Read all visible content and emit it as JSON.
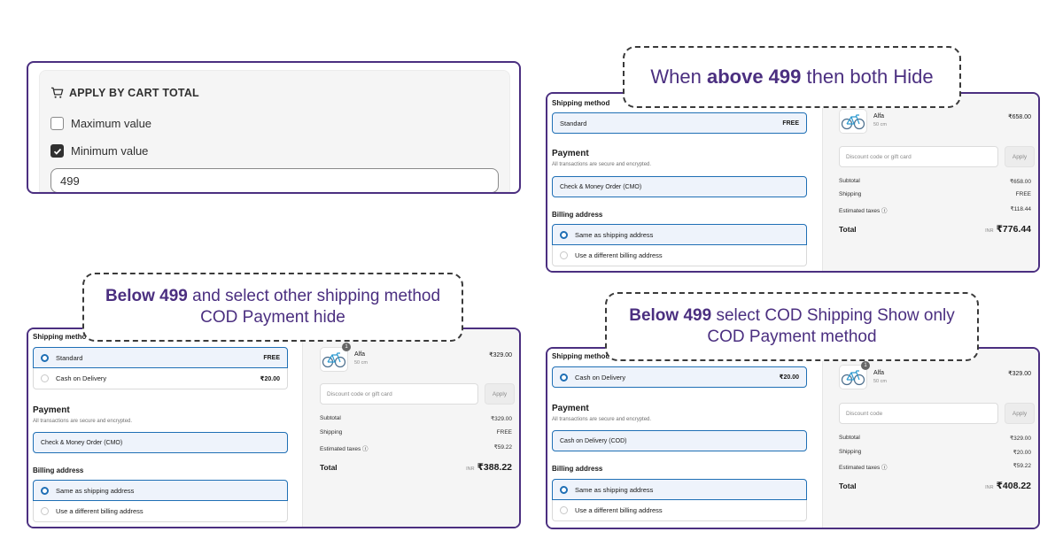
{
  "cart_total_rule": {
    "title": "APPLY BY CART TOTAL",
    "max_label": "Maximum value",
    "max_checked": false,
    "min_label": "Minimum value",
    "min_checked": true,
    "min_value": "499"
  },
  "callouts": {
    "above": {
      "pre": "When ",
      "bold": "above 499",
      "post": " then both Hide"
    },
    "below_other": {
      "bold": "Below 499",
      "post": " and select other shipping method",
      "line2": "COD Payment hide"
    },
    "below_cod": {
      "bold": "Below 499",
      "post": " select COD Shipping Show only",
      "line2": "COD Payment method"
    }
  },
  "checkout_above": {
    "shipping_label": "Shipping method",
    "shipping_options": [
      {
        "name": "Standard",
        "price": "FREE",
        "selected": true
      }
    ],
    "payment_title": "Payment",
    "payment_sub": "All transactions are secure and encrypted.",
    "payment_method": "Check & Money Order (CMO)",
    "billing_label": "Billing address",
    "billing_options": [
      "Same as shipping address",
      "Use a different billing address"
    ],
    "product_name": "Alfa",
    "product_variant": "50 cm",
    "product_price": "₹658.00",
    "discount_placeholder": "Discount code or gift card",
    "apply_label": "Apply",
    "subtotal_label": "Subtotal",
    "subtotal": "₹658.00",
    "shipping_sum_label": "Shipping",
    "shipping_sum": "FREE",
    "taxes_label": "Estimated taxes ⓘ",
    "taxes": "₹118.44",
    "total_label": "Total",
    "currency": "INR",
    "total": "₹776.44"
  },
  "checkout_below_other": {
    "shipping_label": "Shipping method",
    "shipping_options": [
      {
        "name": "Standard",
        "price": "FREE",
        "selected": true
      },
      {
        "name": "Cash on Delivery",
        "price": "₹20.00",
        "selected": false
      }
    ],
    "payment_title": "Payment",
    "payment_sub": "All transactions are secure and encrypted.",
    "payment_method": "Check & Money Order (CMO)",
    "billing_label": "Billing address",
    "billing_options": [
      "Same as shipping address",
      "Use a different billing address"
    ],
    "badge": "1",
    "product_name": "Alfa",
    "product_variant": "50 cm",
    "product_price": "₹329.00",
    "discount_placeholder": "Discount code or gift card",
    "apply_label": "Apply",
    "subtotal_label": "Subtotal",
    "subtotal": "₹329.00",
    "shipping_sum_label": "Shipping",
    "shipping_sum": "FREE",
    "taxes_label": "Estimated taxes ⓘ",
    "taxes": "₹59.22",
    "total_label": "Total",
    "currency": "INR",
    "total": "₹388.22"
  },
  "checkout_below_cod": {
    "shipping_label": "Shipping method",
    "shipping_options": [
      {
        "name": "Cash on Delivery",
        "price": "₹20.00",
        "selected": true
      }
    ],
    "payment_title": "Payment",
    "payment_sub": "All transactions are secure and encrypted.",
    "payment_method": "Cash on Delivery (COD)",
    "billing_label": "Billing address",
    "billing_options": [
      "Same as shipping address",
      "Use a different billing address"
    ],
    "badge": "1",
    "product_name": "Alfa",
    "product_variant": "50 cm",
    "product_price": "₹329.00",
    "discount_placeholder": "Discount code",
    "apply_label": "Apply",
    "subtotal_label": "Subtotal",
    "subtotal": "₹329.00",
    "shipping_sum_label": "Shipping",
    "shipping_sum": "₹20.00",
    "taxes_label": "Estimated taxes ⓘ",
    "taxes": "₹59.22",
    "total_label": "Total",
    "currency": "INR",
    "total": "₹408.22"
  },
  "colors": {
    "frame": "#4b2f80",
    "callout_text": "#4b2f80",
    "selected_border": "#1f6fb5",
    "selected_bg": "#eef3fb"
  },
  "icons": {
    "cart": "cart-icon",
    "check": "check-icon",
    "bicycle": "bicycle-icon"
  }
}
